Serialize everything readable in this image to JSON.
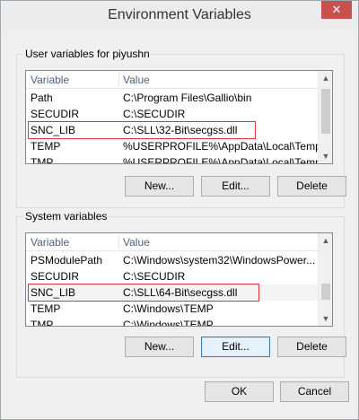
{
  "window": {
    "title": "Environment Variables",
    "close_glyph": "✕"
  },
  "user_group": {
    "label": "User variables for piyushn",
    "columns": [
      "Variable",
      "Value"
    ],
    "rows": [
      {
        "variable": "Path",
        "value": "C:\\Program Files\\Gallio\\bin"
      },
      {
        "variable": "SECUDIR",
        "value": "C:\\SECUDIR"
      },
      {
        "variable": "SNC_LIB",
        "value": "C:\\SLL\\32-Bit\\secgss.dll"
      },
      {
        "variable": "TEMP",
        "value": "%USERPROFILE%\\AppData\\Local\\Temp"
      },
      {
        "variable": "TMP",
        "value": "%USERPROFILE%\\AppData\\Local\\Temp"
      }
    ],
    "buttons": {
      "new": "New...",
      "edit": "Edit...",
      "delete": "Delete"
    }
  },
  "system_group": {
    "label": "System variables",
    "columns": [
      "Variable",
      "Value"
    ],
    "rows": [
      {
        "variable": "PSModulePath",
        "value": "C:\\Windows\\system32\\WindowsPower..."
      },
      {
        "variable": "SECUDIR",
        "value": "C:\\SECUDIR"
      },
      {
        "variable": "SNC_LIB",
        "value": "C:\\SLL\\64-Bit\\secgss.dll"
      },
      {
        "variable": "TEMP",
        "value": "C:\\Windows\\TEMP"
      },
      {
        "variable": "TMP",
        "value": "C:\\Windows\\TEMP"
      }
    ],
    "buttons": {
      "new": "New...",
      "edit": "Edit...",
      "delete": "Delete"
    }
  },
  "footer": {
    "ok": "OK",
    "cancel": "Cancel"
  },
  "colors": {
    "highlight_box": "#e0333b",
    "close_button": "#c75050"
  },
  "icons": {
    "close": "close-icon",
    "scroll_up": "scroll-up-arrow-icon",
    "scroll_down": "scroll-down-arrow-icon"
  }
}
